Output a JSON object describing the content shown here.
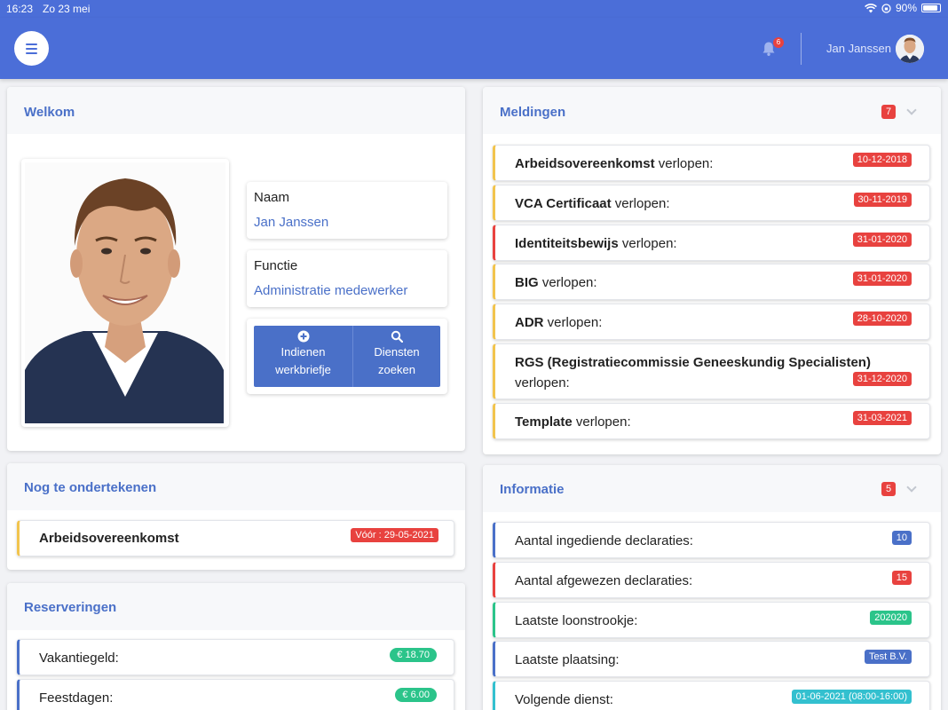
{
  "status_bar": {
    "time": "16:23",
    "date": "Zo 23 mei",
    "battery": "90%",
    "battery_level": 0.9
  },
  "header": {
    "notification_count": "6",
    "user_name": "Jan Janssen"
  },
  "welkom": {
    "title": "Welkom",
    "name_label": "Naam",
    "name_value": "Jan Janssen",
    "function_label": "Functie",
    "function_value": "Administratie medewerker",
    "btn_submit_line1": "Indienen",
    "btn_submit_line2": "werkbriefje",
    "btn_search_line1": "Diensten",
    "btn_search_line2": "zoeken"
  },
  "nog_te_ondertekenen": {
    "title": "Nog te ondertekenen",
    "items": [
      {
        "label": "Arbeidsovereenkomst",
        "tag": "Vóór : 29-05-2021"
      }
    ]
  },
  "reserveringen": {
    "title": "Reserveringen",
    "items": [
      {
        "label": "Vakantiegeld:",
        "value": "€ 18.70"
      },
      {
        "label": "Feestdagen:",
        "value": "€ 6.00"
      }
    ]
  },
  "meldingen": {
    "title": "Meldingen",
    "count": "7",
    "items": [
      {
        "bold": "Arbeidsovereenkomst",
        "rest": " verlopen:",
        "date": "10-12-2018"
      },
      {
        "bold": "VCA Certificaat",
        "rest": " verlopen:",
        "date": "30-11-2019"
      },
      {
        "bold": "Identiteitsbewijs",
        "rest": " verlopen:",
        "date": "31-01-2020"
      },
      {
        "bold": "BIG",
        "rest": " verlopen:",
        "date": "31-01-2020"
      },
      {
        "bold": "ADR",
        "rest": " verlopen:",
        "date": "28-10-2020"
      },
      {
        "bold": "RGS (Registratiecommissie Geneeskundig Specialisten)",
        "rest": "verlopen:",
        "date": "31-12-2020"
      },
      {
        "bold": "Template",
        "rest": " verlopen:",
        "date": "31-03-2021"
      }
    ]
  },
  "informatie": {
    "title": "Informatie",
    "count": "5",
    "items": [
      {
        "label": "Aantal ingediende declaraties:",
        "value": "10"
      },
      {
        "label": "Aantal afgewezen declaraties:",
        "value": "15"
      },
      {
        "label": "Laatste loonstrookje:",
        "value": "202020"
      },
      {
        "label": "Laatste plaatsing:",
        "value": "Test B.V."
      },
      {
        "label": "Volgende dienst:",
        "value": "01-06-2021 (08:00-16:00)"
      }
    ]
  },
  "colors": {
    "primary": "#4b6ed8",
    "danger": "#e8423f",
    "warning": "#f2c44d",
    "success": "#2bc48a",
    "info": "#33c0cf"
  }
}
